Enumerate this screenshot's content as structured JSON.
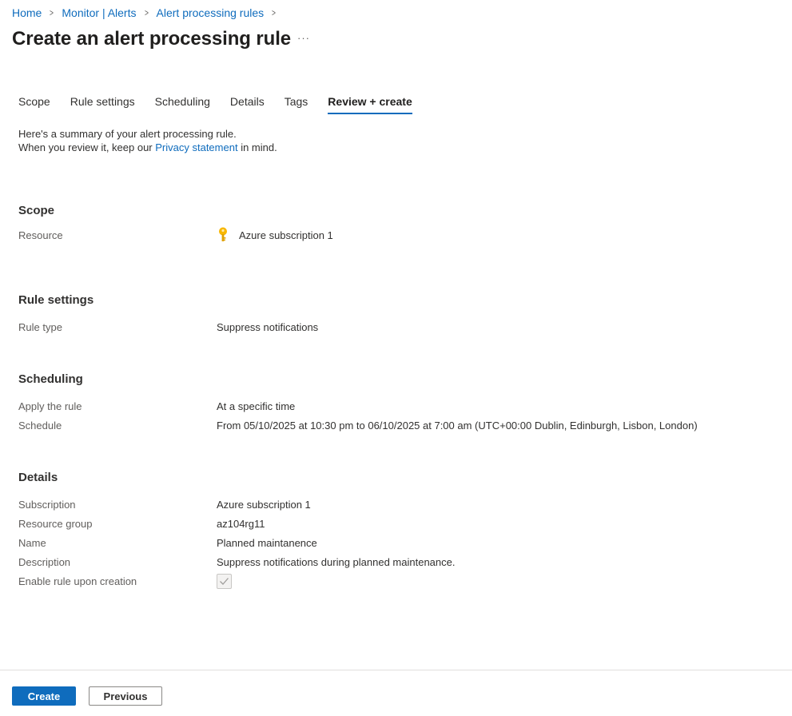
{
  "breadcrumb": [
    {
      "label": "Home"
    },
    {
      "label": "Monitor | Alerts"
    },
    {
      "label": "Alert processing rules"
    }
  ],
  "page_title": "Create an alert processing rule",
  "more_label": "···",
  "tabs": [
    {
      "label": "Scope"
    },
    {
      "label": "Rule settings"
    },
    {
      "label": "Scheduling"
    },
    {
      "label": "Details"
    },
    {
      "label": "Tags"
    },
    {
      "label": "Review + create",
      "active": true
    }
  ],
  "intro": {
    "line1": "Here's a summary of your alert processing rule.",
    "line2_before": "When you review it, keep our ",
    "line2_link": "Privacy statement",
    "line2_after": " in mind."
  },
  "scope": {
    "title": "Scope",
    "resource_label": "Resource",
    "resource_value": "Azure subscription 1",
    "resource_icon": "key-icon"
  },
  "rule_settings": {
    "title": "Rule settings",
    "rule_type_label": "Rule type",
    "rule_type_value": "Suppress notifications"
  },
  "scheduling": {
    "title": "Scheduling",
    "apply_label": "Apply the rule",
    "apply_value": "At a specific time",
    "schedule_label": "Schedule",
    "schedule_value": "From 05/10/2025 at 10:30 pm to 06/10/2025 at 7:00 am (UTC+00:00 Dublin, Edinburgh, Lisbon, London)"
  },
  "details": {
    "title": "Details",
    "subscription_label": "Subscription",
    "subscription_value": "Azure subscription 1",
    "resource_group_label": "Resource group",
    "resource_group_value": "az104rg11",
    "name_label": "Name",
    "name_value": "Planned maintanence",
    "description_label": "Description",
    "description_value": "Suppress notifications during planned maintenance.",
    "enable_label": "Enable rule upon creation",
    "enable_checked": true
  },
  "footer": {
    "create_label": "Create",
    "previous_label": "Previous"
  },
  "colors": {
    "accent": "#0f6cbd",
    "key_icon": "#f8b700"
  }
}
